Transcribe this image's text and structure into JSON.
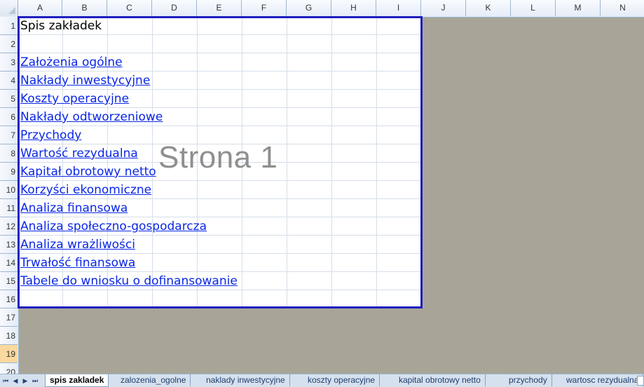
{
  "columns": [
    "A",
    "B",
    "C",
    "D",
    "E",
    "F",
    "G",
    "H",
    "I",
    "J",
    "K",
    "L",
    "M",
    "N"
  ],
  "rows": [
    "1",
    "2",
    "3",
    "4",
    "5",
    "6",
    "7",
    "8",
    "9",
    "10",
    "11",
    "12",
    "13",
    "14",
    "15",
    "16",
    "17",
    "18",
    "19",
    "20"
  ],
  "selected_row": "19",
  "sheet_title": "Spis zakładek",
  "watermark": "Strona 1",
  "links": [
    "Założenia ogólne",
    "Nakłady inwestycyjne",
    "Koszty operacyjne",
    "Nakłady odtworzeniowe",
    "Przychody",
    "Wartość rezydualna",
    "Kapitał obrotowy netto",
    "Korzyści ekonomiczne",
    "Analiza finansowa",
    "Analiza społeczno-gospodarcza",
    "Analiza wrażliwości",
    "Trwałość finansowa",
    "Tabele do wniosku o dofinansowanie"
  ],
  "tab_nav": [
    "⏮",
    "◀",
    "▶",
    "⏭"
  ],
  "tabs": [
    "spis zakladek",
    "zalozenia_ogolne",
    "naklady inwestycyjne",
    "koszty operacyjne",
    "kapital obrotowy netto",
    "przychody",
    "wartosc rezydualna"
  ],
  "colors": {
    "link": "#0a27e6",
    "page_border": "#1f1fc0",
    "background": "#a8a598"
  }
}
